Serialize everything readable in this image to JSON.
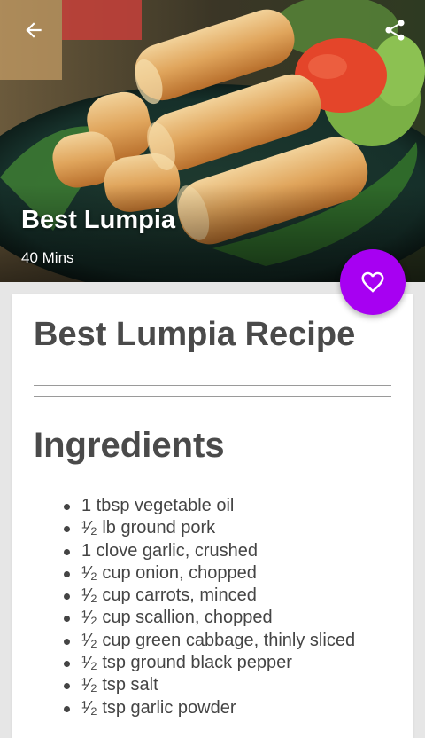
{
  "header": {
    "title": "Best Lumpia",
    "cook_time": "40 Mins",
    "back_icon": "arrow-left-icon",
    "share_icon": "share-icon"
  },
  "favorite": {
    "icon": "heart-outline-icon",
    "color": "#a700f2"
  },
  "recipe": {
    "title": "Best Lumpia Recipe",
    "ingredients_heading": "Ingredients",
    "ingredients": [
      "1 tbsp vegetable oil",
      "¹⁄₂ lb ground pork",
      "1 clove garlic, crushed",
      "¹⁄₂ cup onion, chopped",
      "¹⁄₂ cup carrots, minced",
      "¹⁄₂ cup scallion, chopped",
      "¹⁄₂ cup green cabbage, thinly sliced",
      "¹⁄₂ tsp ground black pepper",
      "¹⁄₂ tsp salt",
      "¹⁄₂ tsp garlic powder"
    ]
  }
}
